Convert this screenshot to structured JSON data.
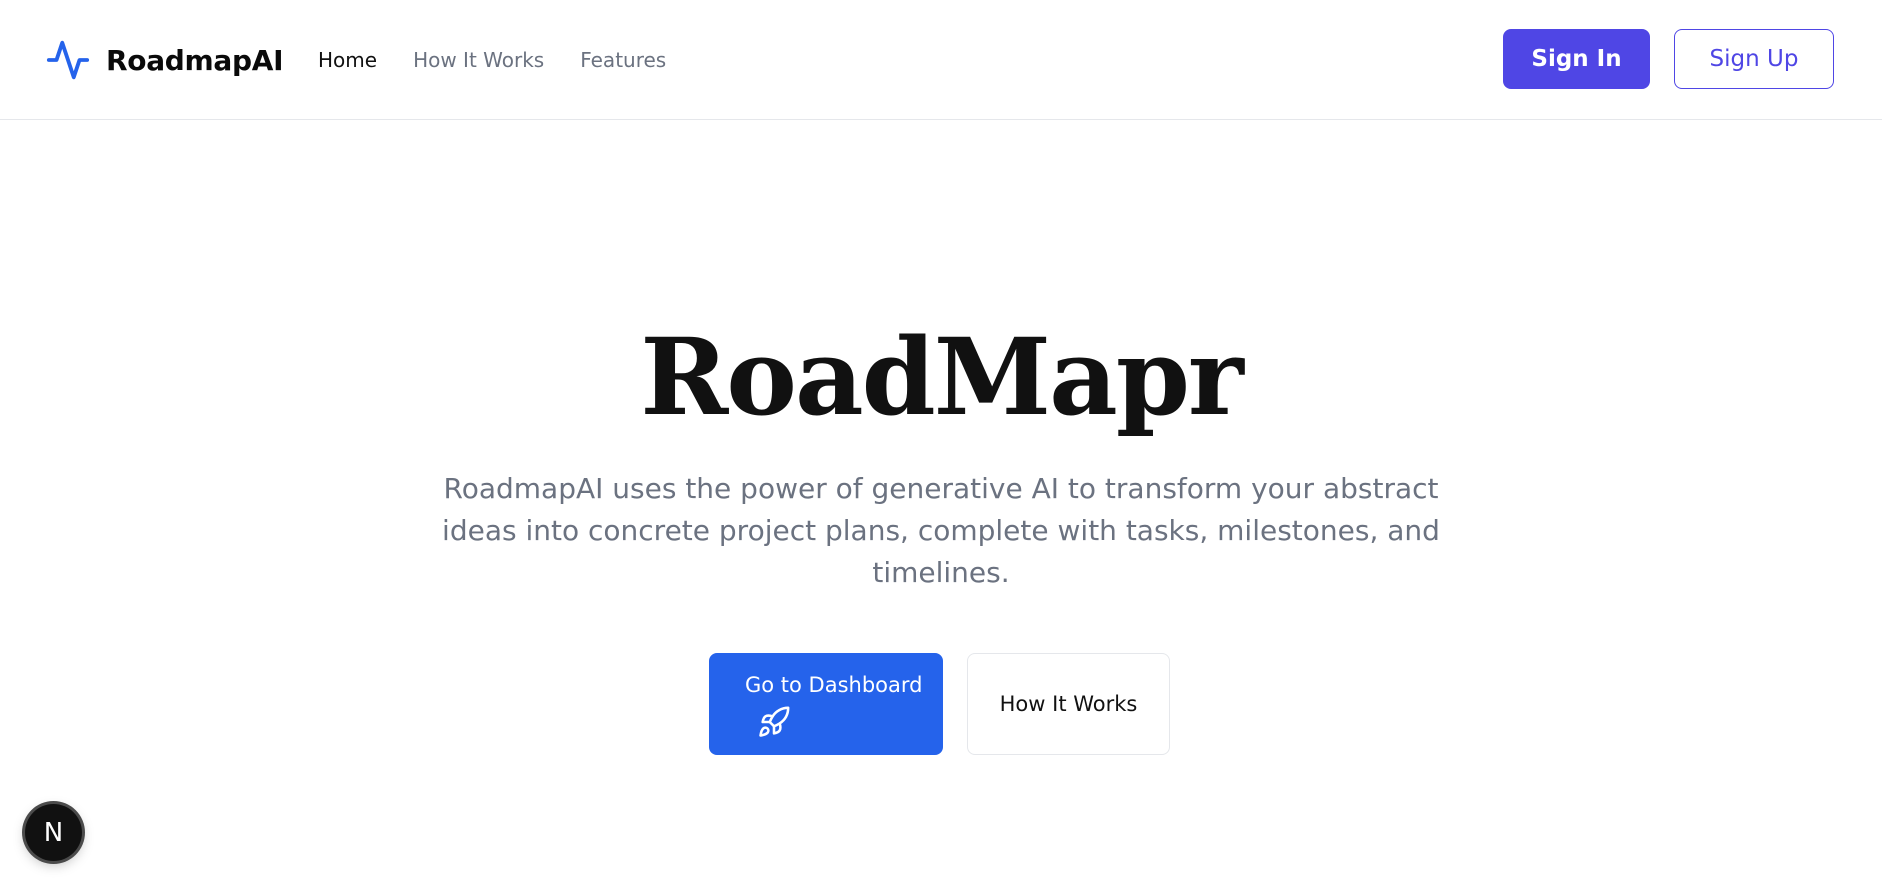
{
  "header": {
    "brand_name": "RoadmapAI",
    "brand_icon": "activity-pulse-icon",
    "nav": [
      {
        "label": "Home",
        "active": true
      },
      {
        "label": "How It Works",
        "active": false
      },
      {
        "label": "Features",
        "active": false
      }
    ],
    "signin_label": "Sign In",
    "signup_label": "Sign Up"
  },
  "hero": {
    "title": "RoadMapr",
    "description": "RoadmapAI uses the power of generative AI to transform your abstract ideas into concrete project plans, complete with tasks, milestones, and timelines.",
    "primary_button": {
      "label": "Go to Dashboard",
      "icon": "rocket-icon"
    },
    "secondary_button": {
      "label": "How It Works"
    }
  },
  "dev_badge": {
    "label": "N"
  },
  "colors": {
    "brand_accent": "#2563eb",
    "signin_bg": "#4f46e5",
    "primary_button_bg": "#2563eb",
    "muted_text": "#6b7280"
  }
}
